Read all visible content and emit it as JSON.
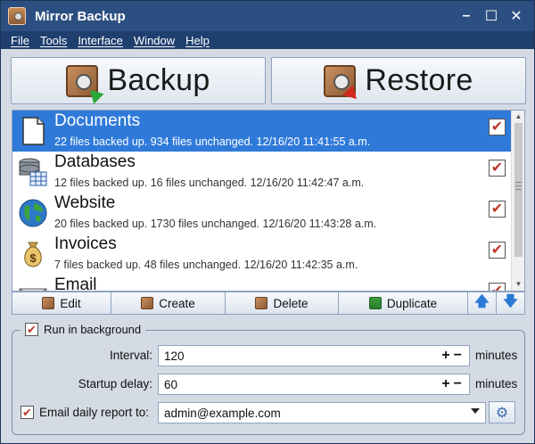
{
  "window": {
    "title": "Mirror Backup",
    "controls": [
      "–",
      "☐",
      "✕"
    ]
  },
  "menu": [
    "File",
    "Tools",
    "Interface",
    "Window",
    "Help"
  ],
  "actions": {
    "backup": "Backup",
    "restore": "Restore"
  },
  "jobs": [
    {
      "name": "Documents",
      "detail": "22 files backed up.  934 files unchanged.  12/16/20 11:41:55 a.m.",
      "icon": "document-icon",
      "checked": true,
      "selected": true
    },
    {
      "name": "Databases",
      "detail": "12 files backed up.  16 files unchanged.  12/16/20 11:42:47 a.m.",
      "icon": "database-icon",
      "checked": true,
      "selected": false
    },
    {
      "name": "Website",
      "detail": "20 files backed up.  1730 files unchanged.  12/16/20 11:43:28 a.m.",
      "icon": "globe-icon",
      "checked": true,
      "selected": false
    },
    {
      "name": "Invoices",
      "detail": "7 files backed up.  48 files unchanged.  12/16/20 11:42:35 a.m.",
      "icon": "money-bag-icon",
      "checked": true,
      "selected": false
    },
    {
      "name": "Email",
      "detail": "",
      "icon": "email-icon",
      "checked": true,
      "selected": false
    }
  ],
  "toolbar": {
    "edit": "Edit",
    "create": "Create",
    "delete": "Delete",
    "duplicate": "Duplicate",
    "up": "🡅",
    "down": "🡇"
  },
  "settings": {
    "run_in_background": "Run in background",
    "interval_label": "Interval:",
    "interval_value": "120",
    "startup_label": "Startup delay:",
    "startup_value": "60",
    "email_label": "Email daily report to:",
    "email_value": "admin@example.com",
    "units": "minutes",
    "stepper": "+−",
    "check": "✔"
  },
  "colors": {
    "titlebar": "#2b4f80",
    "selection": "#2f7ad9",
    "checkmark": "#c0392b"
  }
}
